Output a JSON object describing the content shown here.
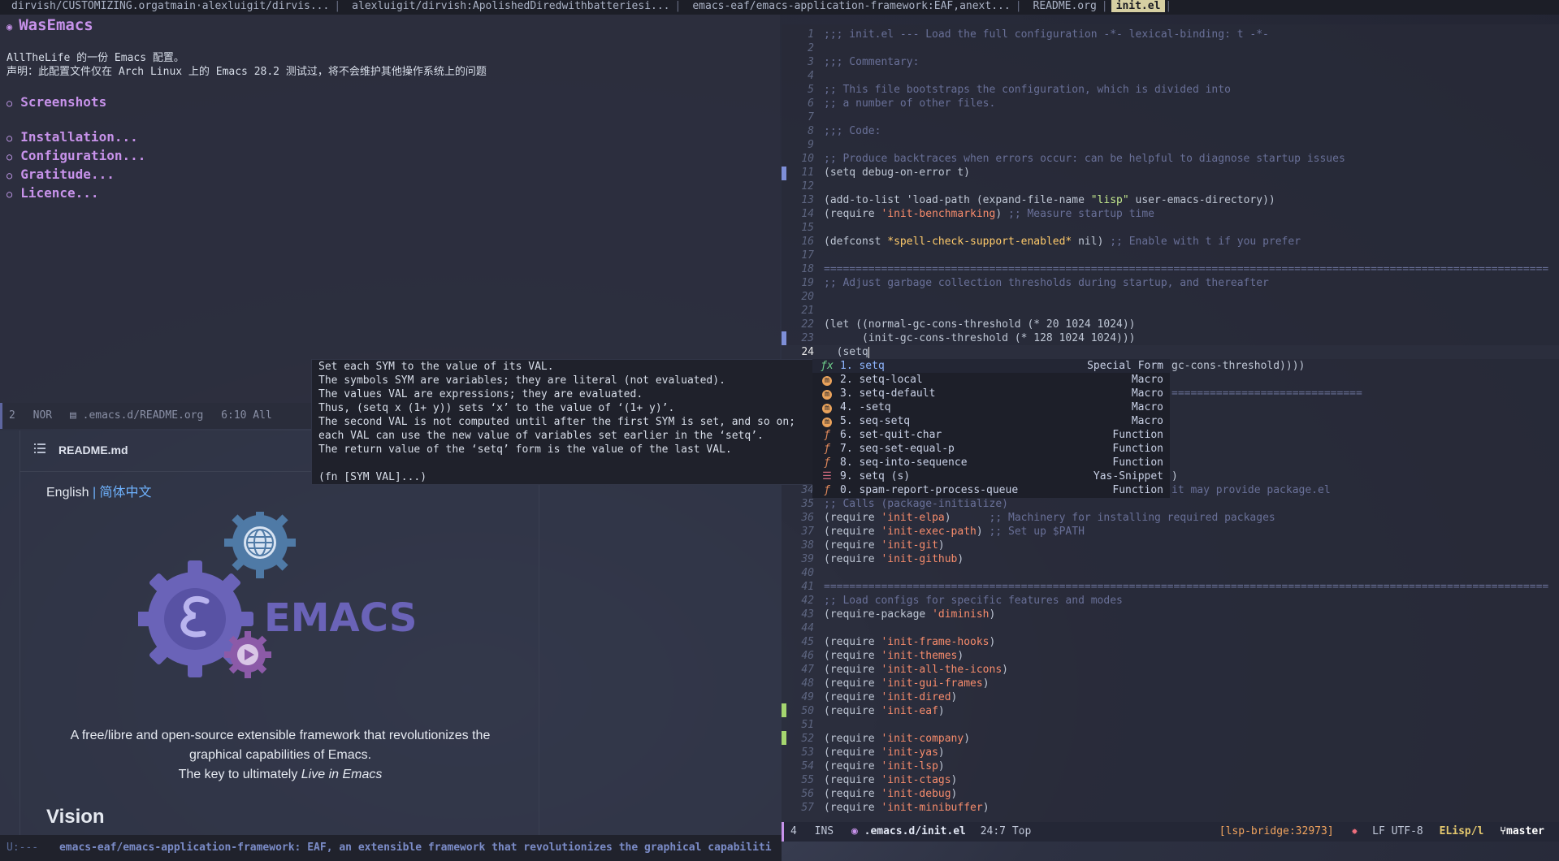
{
  "tabbar": {
    "tabs": [
      "dirvish/CUSTOMIZING.orgatmain·alexluigit/dirvis...",
      "alexluigit/dirvish:ApolishedDiredwithbatteriesi...",
      "emacs-eaf/emacs-application-framework:EAF,anext...",
      "README.org",
      "init.el"
    ]
  },
  "org": {
    "title": "WasEmacs",
    "intro1": "AllTheLife 的一份 Emacs 配置。",
    "intro2": "声明：此配置文件仅在 Arch Linux 上的 Emacs 28.2 测试过，将不会维护其他操作系统上的问题",
    "screenshots": "Screenshots",
    "installation": "Installation...",
    "configuration": "Configuration...",
    "gratitude": "Gratitude...",
    "licence": "Licence..."
  },
  "modeline_left": {
    "num": "2",
    "state": "NOR",
    "file": ".emacs.d/README.org",
    "pos": "6:10 All"
  },
  "readme": {
    "filename": "README.md",
    "lang_en": "English",
    "lang_sep": "|",
    "lang_zh": "简体中文",
    "desc1": "A free/libre and open-source extensible framework that revolutionizes the",
    "desc2": "graphical capabilities of Emacs.",
    "desc3_prefix": "The key to ultimately ",
    "desc3_em": "Live in Emacs",
    "vision": "Vision",
    "logo_text": "EMACS"
  },
  "echo": {
    "prefix": "U:---",
    "message": "emacs-eaf/emacs-application-framework: EAF, an extensible framework that revolutionizes the graphical capabiliti"
  },
  "doc": {
    "lines": [
      "Set each SYM to the value of its VAL.",
      "The symbols SYM are variables; they are literal (not evaluated).",
      "The values VAL are expressions; they are evaluated.",
      "Thus, (setq x (1+ y)) sets ‘x’ to the value of ‘(1+ y)’.",
      "The second VAL is not computed until after the first SYM is set, and so on;",
      "each VAL can use the new value of variables set earlier in the ‘setq’.",
      "The return value of the ‘setq’ form is the value of the last VAL.",
      "",
      "(fn [SYM VAL]...)"
    ]
  },
  "completion": [
    {
      "icon": "ƒx",
      "label": "1. setq",
      "kind": "Special Form"
    },
    {
      "icon": "m",
      "label": "2. setq-local",
      "kind": "Macro"
    },
    {
      "icon": "m",
      "label": "3. setq-default",
      "kind": "Macro"
    },
    {
      "icon": "m",
      "label": "4. -setq",
      "kind": "Macro"
    },
    {
      "icon": "m",
      "label": "5. seq-setq",
      "kind": "Macro"
    },
    {
      "icon": "ƒ",
      "label": "6. set-quit-char",
      "kind": "Function"
    },
    {
      "icon": "ƒ",
      "label": "7. seq-set-equal-p",
      "kind": "Function"
    },
    {
      "icon": "ƒ",
      "label": "8. seq-into-sequence",
      "kind": "Function"
    },
    {
      "icon": "☰",
      "label": "9. setq (s)",
      "kind": "Yas-Snippet"
    },
    {
      "icon": "ƒ",
      "label": "0. spam-report-process-queue",
      "kind": "Function"
    }
  ],
  "code": {
    "l1": ";;; init.el --- Load the full configuration -*- lexical-binding: t -*-",
    "l3": ";;; Commentary:",
    "l5": ";; This file bootstraps the configuration, which is divided into",
    "l6": ";; a number of other files.",
    "l8": ";;; Code:",
    "l10": ";; Produce backtraces when errors occur: can be helpful to diagnose startup issues",
    "l11": "(setq debug-on-error t)",
    "l13a": "(add-to-list 'load-path (expand-file-name ",
    "l13s": "\"lisp\"",
    "l13b": " user-emacs-directory))",
    "l14a": "(require ",
    "l14q": "'init-benchmarking",
    "l14b": ") ",
    "l14c": ";; Measure startup time",
    "l16a": "(defconst ",
    "l16v": "*spell-check-support-enabled*",
    "l16b": " nil) ",
    "l16c": ";; Enable with t if you prefer",
    "l18": "==================================================================================================================",
    "l19": ";; Adjust garbage collection thresholds during startup, and thereafter",
    "l22": "(let ((normal-gc-cons-threshold (* 20 1024 1024))",
    "l23": "      (init-gc-cons-threshold (* 128 1024 1024)))",
    "l24": "  (setq",
    "l25tail": "gc-cons-threshold))))",
    "l27tail": "==============================",
    "l33tail": ")",
    "l34tail": "it may provide package.el",
    "l35": ";; Calls (package-initialize)",
    "l36c": "      ;; Machinery for installing required packages",
    "l37c": " ;; Set up $PATH",
    "l41": "==================================================================================================================",
    "l42": ";; Load configs for specific features and modes",
    "l43a": "(require-package ",
    "l43q": "'diminish",
    "l43b": ")",
    "requires": {
      "l36": "'init-elpa",
      "l37": "'init-exec-path",
      "l38": "'init-git",
      "l39": "'init-github",
      "l45": "'init-frame-hooks",
      "l46": "'init-themes",
      "l47": "'init-all-the-icons",
      "l48": "'init-gui-frames",
      "l49": "'init-dired",
      "l50": "'init-eaf",
      "l52": "'init-company",
      "l53": "'init-yas",
      "l54": "'init-lsp",
      "l55": "'init-ctags",
      "l56": "'init-debug",
      "l57": "'init-minibuffer"
    },
    "require_kw": "(require ",
    "close": ")"
  },
  "modeline_right": {
    "num": "4",
    "state": "INS",
    "file": ".emacs.d/init.el",
    "pos": "24:7 Top",
    "lsp": "[lsp-bridge:32973]",
    "eol": "LF UTF-8",
    "mode": "ELisp/l",
    "branch": "master"
  }
}
